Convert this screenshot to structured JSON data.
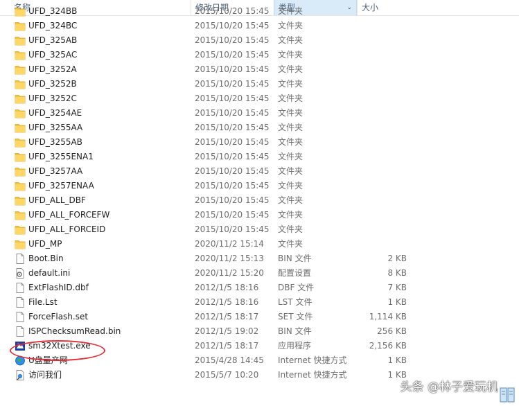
{
  "columns": {
    "name": "名称",
    "date": "修改日期",
    "type": "类型",
    "size": "大小"
  },
  "files": [
    {
      "name": "UFD_324BB",
      "date": "2015/10/20 15:45",
      "type": "文件夹",
      "size": "",
      "icon": "folder-icon"
    },
    {
      "name": "UFD_324BC",
      "date": "2015/10/20 15:45",
      "type": "文件夹",
      "size": "",
      "icon": "folder-icon"
    },
    {
      "name": "UFD_325AB",
      "date": "2015/10/20 15:45",
      "type": "文件夹",
      "size": "",
      "icon": "folder-icon"
    },
    {
      "name": "UFD_325AC",
      "date": "2015/10/20 15:45",
      "type": "文件夹",
      "size": "",
      "icon": "folder-icon"
    },
    {
      "name": "UFD_3252A",
      "date": "2015/10/20 15:45",
      "type": "文件夹",
      "size": "",
      "icon": "folder-icon"
    },
    {
      "name": "UFD_3252B",
      "date": "2015/10/20 15:45",
      "type": "文件夹",
      "size": "",
      "icon": "folder-icon"
    },
    {
      "name": "UFD_3252C",
      "date": "2015/10/20 15:45",
      "type": "文件夹",
      "size": "",
      "icon": "folder-icon"
    },
    {
      "name": "UFD_3254AE",
      "date": "2015/10/20 15:45",
      "type": "文件夹",
      "size": "",
      "icon": "folder-icon"
    },
    {
      "name": "UFD_3255AA",
      "date": "2015/10/20 15:45",
      "type": "文件夹",
      "size": "",
      "icon": "folder-icon"
    },
    {
      "name": "UFD_3255AB",
      "date": "2015/10/20 15:45",
      "type": "文件夹",
      "size": "",
      "icon": "folder-icon"
    },
    {
      "name": "UFD_3255ENA1",
      "date": "2015/10/20 15:45",
      "type": "文件夹",
      "size": "",
      "icon": "folder-icon"
    },
    {
      "name": "UFD_3257AA",
      "date": "2015/10/20 15:45",
      "type": "文件夹",
      "size": "",
      "icon": "folder-icon"
    },
    {
      "name": "UFD_3257ENAA",
      "date": "2015/10/20 15:45",
      "type": "文件夹",
      "size": "",
      "icon": "folder-icon"
    },
    {
      "name": "UFD_ALL_DBF",
      "date": "2015/10/20 15:45",
      "type": "文件夹",
      "size": "",
      "icon": "folder-icon"
    },
    {
      "name": "UFD_ALL_FORCEFW",
      "date": "2015/10/20 15:45",
      "type": "文件夹",
      "size": "",
      "icon": "folder-icon"
    },
    {
      "name": "UFD_ALL_FORCEID",
      "date": "2015/10/20 15:45",
      "type": "文件夹",
      "size": "",
      "icon": "folder-icon"
    },
    {
      "name": "UFD_MP",
      "date": "2020/11/2 15:14",
      "type": "文件夹",
      "size": "",
      "icon": "folder-icon"
    },
    {
      "name": "Boot.Bin",
      "date": "2020/11/2 15:13",
      "type": "BIN 文件",
      "size": "2 KB",
      "icon": "file-icon"
    },
    {
      "name": "default.ini",
      "date": "2020/11/2 15:20",
      "type": "配置设置",
      "size": "8 KB",
      "icon": "settings-file-icon"
    },
    {
      "name": "ExtFlashID.dbf",
      "date": "2012/1/5 18:16",
      "type": "DBF 文件",
      "size": "7 KB",
      "icon": "file-icon"
    },
    {
      "name": "File.Lst",
      "date": "2012/1/5 18:16",
      "type": "LST 文件",
      "size": "1 KB",
      "icon": "file-icon"
    },
    {
      "name": "ForceFlash.set",
      "date": "2012/1/5 18:17",
      "type": "SET 文件",
      "size": "1,114 KB",
      "icon": "file-icon"
    },
    {
      "name": "ISPChecksumRead.bin",
      "date": "2012/1/5 19:02",
      "type": "BIN 文件",
      "size": "256 KB",
      "icon": "file-icon"
    },
    {
      "name": "sm32Xtest.exe",
      "date": "2012/1/5 18:17",
      "type": "应用程序",
      "size": "2,156 KB",
      "icon": "app-exe-icon"
    },
    {
      "name": "U盘量产网",
      "date": "2015/4/28 14:45",
      "type": "Internet 快捷方式",
      "size": "1 KB",
      "icon": "globe-icon"
    },
    {
      "name": "访问我们",
      "date": "2015/5/7 10:20",
      "type": "Internet 快捷方式",
      "size": "1 KB",
      "icon": "web-shortcut-icon"
    }
  ],
  "watermark": "头条 @林子爱玩机",
  "colors": {
    "folder": "#f4c542",
    "header_selected": "#d9ebf9",
    "annotation_circle": "#e0303a"
  }
}
